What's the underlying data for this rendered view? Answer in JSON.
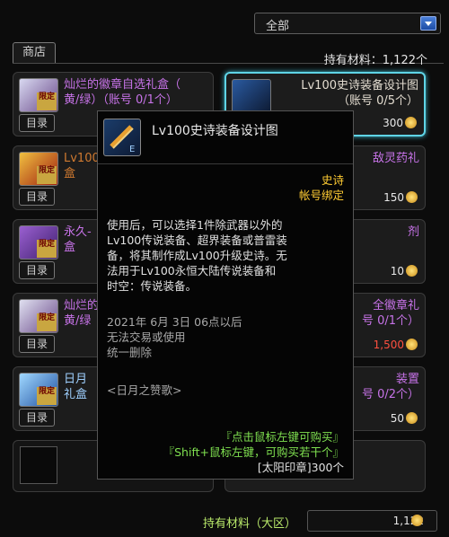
{
  "filter": {
    "label": "全部"
  },
  "shop_tab": "商店",
  "owned_materials": {
    "label": "持有材料：",
    "value": "1,122个"
  },
  "items": [
    {
      "name": "灿烂的徽章自选礼盒（\n黄/绿）（账号 0/1个）",
      "price": "",
      "limited": "限定",
      "menu": "目录",
      "color": "#c773e8"
    },
    {
      "name": "Lv100史诗装备设计图\n（账号 0/5个）",
      "price": "300",
      "limited": "",
      "menu": "",
      "color": "#e3dcd0"
    },
    {
      "name": "Lv100\n盒",
      "price": "",
      "limited": "限定",
      "menu": "目录",
      "color": "#d07a30"
    },
    {
      "name": "敌灵药礼",
      "price": "150",
      "limited": "",
      "menu": "",
      "color": "#c773e8"
    },
    {
      "name": "永久-\n盒",
      "price": "",
      "limited": "限定",
      "menu": "目录",
      "color": "#c773e8"
    },
    {
      "name": "剂",
      "price": "10",
      "limited": "",
      "menu": "",
      "color": "#c773e8"
    },
    {
      "name": "灿烂的\n黄/绿",
      "price": "",
      "limited": "限定",
      "menu": "目录",
      "color": "#c773e8"
    },
    {
      "name": "全徽章礼\n号 0/1个）",
      "price": "1,500",
      "limited": "",
      "menu": "",
      "color": "#c773e8"
    },
    {
      "name": "日月\n礼盒",
      "price": "",
      "limited": "限定",
      "menu": "目录",
      "color": "#9fd0ff"
    },
    {
      "name": "装置\n号 0/2个）",
      "price": "50",
      "limited": "",
      "menu": "",
      "color": "#c773e8"
    }
  ],
  "tooltip": {
    "name": "Lv100史诗装备设计图",
    "rarity": "史诗",
    "bind": "帐号绑定",
    "desc": [
      "使用后，可以选择1件除武器以外的",
      "Lv100传说装备、超界装备或普雷装",
      "备，将其制作成Lv100升级史诗。无",
      "法用于Lv100永恒大陆传说装备和",
      "时空：传说装备。"
    ],
    "expire": [
      "2021年 6月 3日 06点以后",
      "无法交易或使用",
      "统一删除"
    ],
    "source": "<日月之赞歌>",
    "buy_click": "『点击鼠标左键可购买』",
    "buy_shift": "『Shift+鼠标左键，可购买若干个』",
    "cost": "[太阳印章]300个"
  },
  "bottom": {
    "label": "持有材料（大区）",
    "value": "1,122"
  },
  "colors": {
    "rarity": "#ffcc33",
    "desc": "#e0e0e0",
    "expire": "#a8a8a8",
    "buy": "#7fe050",
    "selection": "#5fd4e6"
  }
}
